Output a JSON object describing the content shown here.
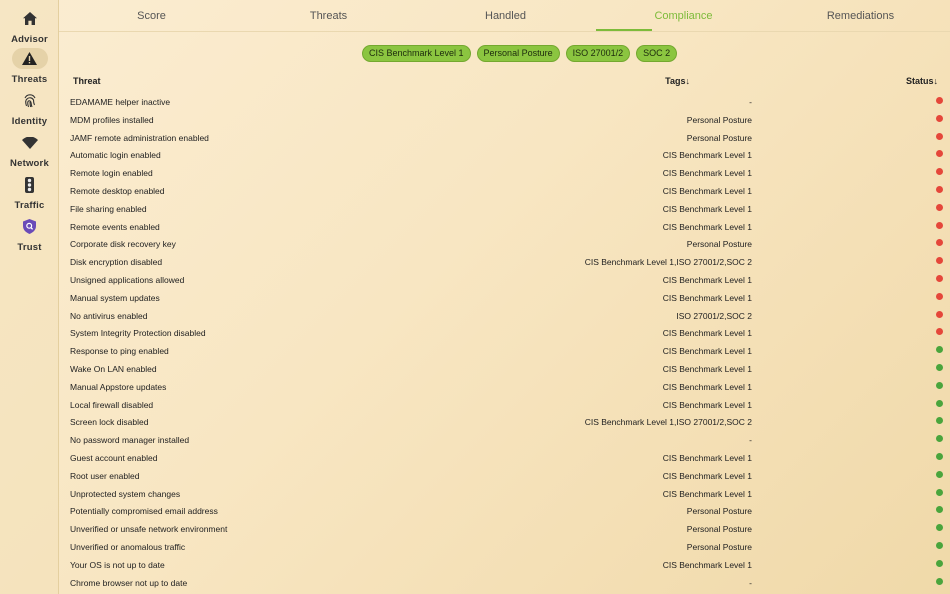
{
  "sidebar": {
    "items": [
      {
        "label": "Advisor",
        "icon": "home-icon",
        "active": false
      },
      {
        "label": "Threats",
        "icon": "warning-icon",
        "active": true
      },
      {
        "label": "Identity",
        "icon": "fingerprint-icon",
        "active": false
      },
      {
        "label": "Network",
        "icon": "wifi-icon",
        "active": false
      },
      {
        "label": "Traffic",
        "icon": "traffic-light-icon",
        "active": false
      },
      {
        "label": "Trust",
        "icon": "shield-search-icon",
        "active": false
      }
    ]
  },
  "tabs": [
    {
      "label": "Score"
    },
    {
      "label": "Threats"
    },
    {
      "label": "Handled"
    },
    {
      "label": "Compliance",
      "active": true
    },
    {
      "label": "Remediations"
    }
  ],
  "filters": [
    "CIS Benchmark Level 1",
    "Personal Posture",
    "ISO 27001/2",
    "SOC 2"
  ],
  "table": {
    "headers": {
      "threat": "Threat",
      "tags": "Tags",
      "status": "Status"
    },
    "sort_arrow": "↓",
    "rows": [
      {
        "threat": "EDAMAME helper inactive",
        "tags": "-",
        "status": "red"
      },
      {
        "threat": "MDM profiles installed",
        "tags": "Personal Posture",
        "status": "red"
      },
      {
        "threat": "JAMF remote administration enabled",
        "tags": "Personal Posture",
        "status": "red"
      },
      {
        "threat": "Automatic login enabled",
        "tags": "CIS Benchmark Level 1",
        "status": "red"
      },
      {
        "threat": "Remote login enabled",
        "tags": "CIS Benchmark Level 1",
        "status": "red"
      },
      {
        "threat": "Remote desktop enabled",
        "tags": "CIS Benchmark Level 1",
        "status": "red"
      },
      {
        "threat": "File sharing enabled",
        "tags": "CIS Benchmark Level 1",
        "status": "red"
      },
      {
        "threat": "Remote events enabled",
        "tags": "CIS Benchmark Level 1",
        "status": "red"
      },
      {
        "threat": "Corporate disk recovery key",
        "tags": "Personal Posture",
        "status": "red"
      },
      {
        "threat": "Disk encryption disabled",
        "tags": "CIS Benchmark Level 1,ISO 27001/2,SOC 2",
        "status": "red"
      },
      {
        "threat": "Unsigned applications allowed",
        "tags": "CIS Benchmark Level 1",
        "status": "red"
      },
      {
        "threat": "Manual system updates",
        "tags": "CIS Benchmark Level 1",
        "status": "red"
      },
      {
        "threat": "No antivirus enabled",
        "tags": "ISO 27001/2,SOC 2",
        "status": "red"
      },
      {
        "threat": "System Integrity Protection disabled",
        "tags": "CIS Benchmark Level 1",
        "status": "red"
      },
      {
        "threat": "Response to ping enabled",
        "tags": "CIS Benchmark Level 1",
        "status": "green"
      },
      {
        "threat": "Wake On LAN enabled",
        "tags": "CIS Benchmark Level 1",
        "status": "green"
      },
      {
        "threat": "Manual Appstore updates",
        "tags": "CIS Benchmark Level 1",
        "status": "green"
      },
      {
        "threat": "Local firewall disabled",
        "tags": "CIS Benchmark Level 1",
        "status": "green"
      },
      {
        "threat": "Screen lock disabled",
        "tags": "CIS Benchmark Level 1,ISO 27001/2,SOC 2",
        "status": "green"
      },
      {
        "threat": "No password manager installed",
        "tags": "-",
        "status": "green"
      },
      {
        "threat": "Guest account enabled",
        "tags": "CIS Benchmark Level 1",
        "status": "green"
      },
      {
        "threat": "Root user enabled",
        "tags": "CIS Benchmark Level 1",
        "status": "green"
      },
      {
        "threat": "Unprotected system changes",
        "tags": "CIS Benchmark Level 1",
        "status": "green"
      },
      {
        "threat": "Potentially compromised email address",
        "tags": "Personal Posture",
        "status": "green"
      },
      {
        "threat": "Unverified or unsafe network environment",
        "tags": "Personal Posture",
        "status": "green"
      },
      {
        "threat": "Unverified or anomalous traffic",
        "tags": "Personal Posture",
        "status": "green"
      },
      {
        "threat": "Your OS is not up to date",
        "tags": "CIS Benchmark Level 1",
        "status": "green"
      },
      {
        "threat": "Chrome browser not up to date",
        "tags": "-",
        "status": "green"
      }
    ]
  },
  "colors": {
    "accent": "#7dbb3a",
    "chip_bg": "#8bc540",
    "status_red": "#e5473a",
    "status_green": "#4aa53c"
  }
}
